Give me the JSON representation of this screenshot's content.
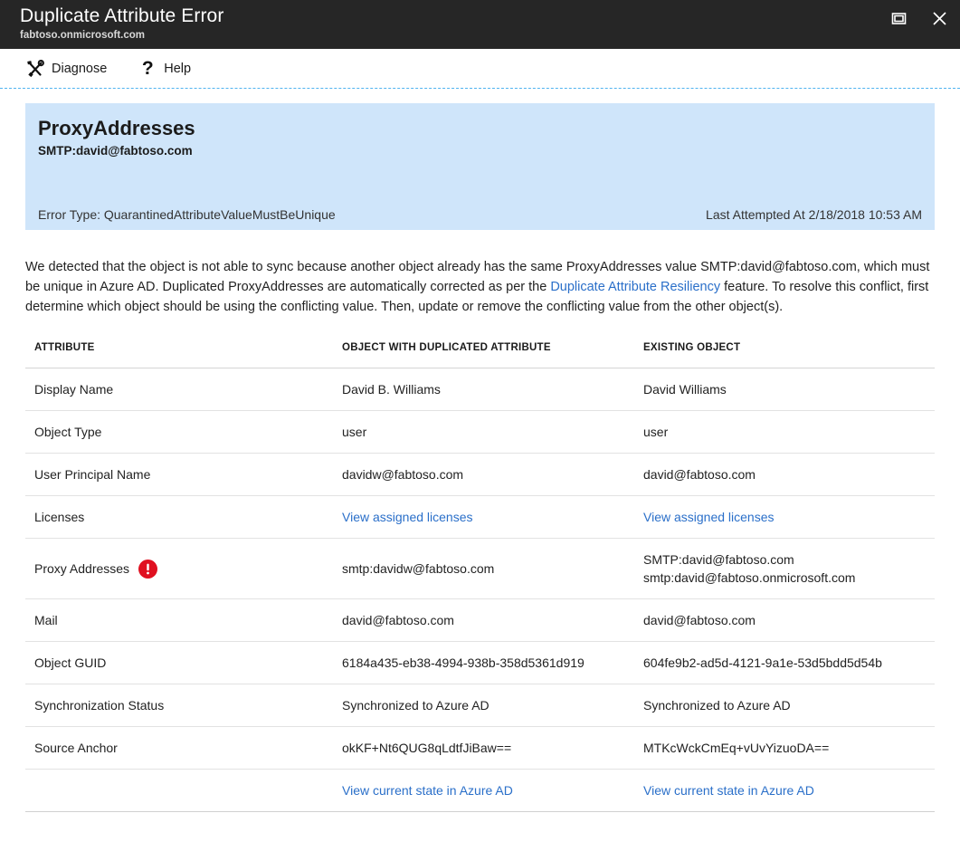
{
  "window": {
    "title": "Duplicate Attribute Error",
    "subtitle": "fabtoso.onmicrosoft.com",
    "restore_label": "Restore",
    "close_label": "Close"
  },
  "toolbar": {
    "diagnose_label": "Diagnose",
    "help_label": "Help",
    "help_glyph": "?"
  },
  "panel": {
    "title": "ProxyAddresses",
    "subtitle": "SMTP:david@fabtoso.com",
    "error_type": "Error Type: QuarantinedAttributeValueMustBeUnique",
    "last_attempted": "Last Attempted At 2/18/2018 10:53 AM",
    "background_color": "#cfe5fa"
  },
  "description": {
    "part1": "We detected that the object is not able to sync because another object already has the same ProxyAddresses value SMTP:david@fabtoso.com, which must be unique in Azure AD. Duplicated ProxyAddresses are automatically corrected as per the ",
    "link_text": "Duplicate Attribute Resiliency",
    "part2": " feature. To resolve this conflict, first determine which object should be using the conflicting value. Then, update or remove the conflicting value from the other object(s)."
  },
  "table": {
    "headers": {
      "attribute": "ATTRIBUTE",
      "duplicated": "OBJECT WITH DUPLICATED ATTRIBUTE",
      "existing": "EXISTING OBJECT"
    },
    "rows": [
      {
        "attribute": "Display Name",
        "duplicated": "David B. Williams",
        "existing": "David Williams"
      },
      {
        "attribute": "Object Type",
        "duplicated": "user",
        "existing": "user"
      },
      {
        "attribute": "User Principal Name",
        "duplicated": "davidw@fabtoso.com",
        "existing": "david@fabtoso.com"
      },
      {
        "attribute": "Licenses",
        "duplicated": "View assigned licenses",
        "existing": "View assigned licenses"
      },
      {
        "attribute": "Proxy Addresses",
        "duplicated": "smtp:davidw@fabtoso.com",
        "existing_line1": "SMTP:david@fabtoso.com",
        "existing_line2": "smtp:david@fabtoso.onmicrosoft.com"
      },
      {
        "attribute": "Mail",
        "duplicated": "david@fabtoso.com",
        "existing": "david@fabtoso.com"
      },
      {
        "attribute": "Object GUID",
        "duplicated": "6184a435-eb38-4994-938b-358d5361d919",
        "existing": "604fe9b2-ad5d-4121-9a1e-53d5bdd5d54b"
      },
      {
        "attribute": "Synchronization Status",
        "duplicated": "Synchronized to Azure AD",
        "existing": "Synchronized to Azure AD"
      },
      {
        "attribute": "Source Anchor",
        "duplicated": "okKF+Nt6QUG8qLdtfJiBaw==",
        "existing": "MTKcWckCmEq+vUvYizuoDA=="
      },
      {
        "attribute": "",
        "duplicated": "View current state in Azure AD",
        "existing": "View current state in Azure AD"
      }
    ]
  },
  "colors": {
    "titlebar": "#262626",
    "link": "#2a6fc9",
    "error_red": "#e01020",
    "accent_dashed": "#4fb3f0"
  }
}
